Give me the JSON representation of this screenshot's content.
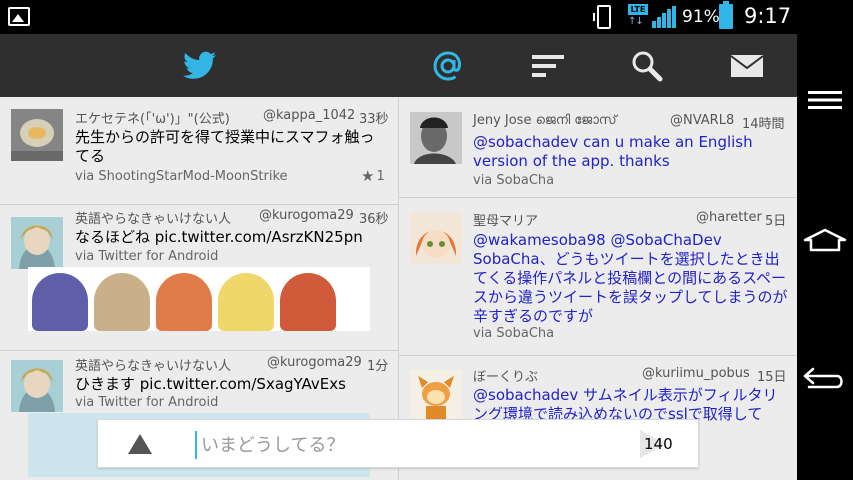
{
  "status_bar": {
    "network": "LTE",
    "battery_percent": "91%",
    "time": "9:17"
  },
  "toolbar": {
    "tabs": [
      {
        "icon": "twitter-bird-icon",
        "active": true
      },
      {
        "icon": "mention-at-icon",
        "active": true
      },
      {
        "icon": "lists-icon",
        "active": false
      },
      {
        "icon": "search-icon",
        "active": false
      },
      {
        "icon": "message-envelope-icon",
        "active": false
      }
    ],
    "accent_color": "#33b5e5"
  },
  "timeline_left": [
    {
      "name": "エケセテネ(「'ω')」\"(公式)",
      "handle": "@kappa_1042",
      "time": "33秒",
      "text": "先生からの許可を得て授業中にスマフォ触ってる",
      "via": "via ShootingStarMod-MoonStrike",
      "favorites": "1"
    },
    {
      "name": "英語やらなきゃいけない人",
      "handle": "@kurogoma29",
      "time": "36秒",
      "text": "なるほどね pic.twitter.com/AsrzKN25pn",
      "via": "via Twitter for Android"
    },
    {
      "name": "英語やらなきゃいけない人",
      "handle": "@kurogoma29",
      "time": "1分",
      "text": "ひきます pic.twitter.com/SxagYAvExs",
      "via": "via Twitter for Android"
    }
  ],
  "timeline_right": [
    {
      "name": "Jeny Jose ജെനി ജോസ്",
      "handle": "@NVARL8",
      "time": "14時間",
      "text": "@sobachadev can u make an English version of the app. thanks",
      "via": "via SobaCha"
    },
    {
      "name": "聖母マリア",
      "handle": "@haretter",
      "time": "5日",
      "text": "@wakamesoba98 @SobaChaDev SobaCha、どうもツイートを選択したとき出てくる操作パネルと投稿欄との間にあるスペースから違うツイートを誤タップしてしまうのが辛すぎるのですが",
      "via": "via SobaCha"
    },
    {
      "name": "ぼーくりぶ",
      "handle": "@kuriimu_pobus",
      "time": "15日",
      "text": "@sobachadev サムネイル表示がフィルタリング環境で読み込めないのでsslで取得して"
    }
  ],
  "compose": {
    "placeholder": "いまどうしてる？",
    "char_count": "140"
  }
}
